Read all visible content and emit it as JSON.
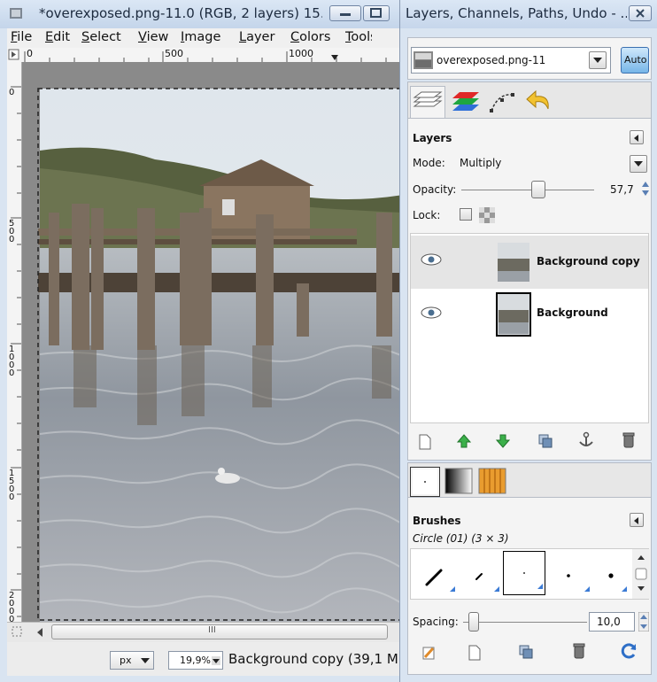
{
  "image_window": {
    "title": "*overexposed.png-11.0 (RGB, 2 layers) 15...",
    "menu": [
      "File",
      "Edit",
      "Select",
      "View",
      "Image",
      "Layer",
      "Colors",
      "Tools"
    ],
    "ruler_h_ticks": [
      "0",
      "500",
      "1000"
    ],
    "ruler_v_ticks": [
      "0",
      "500",
      "1000",
      "1500",
      "2000"
    ],
    "status": {
      "unit": "px",
      "zoom": "19,9%",
      "message": "Background copy (39,1 M"
    },
    "scroll_mark": "III"
  },
  "dock": {
    "title": "Layers, Channels, Paths, Undo - ...",
    "image_select": "overexposed.png-11",
    "auto_label": "Auto",
    "layers": {
      "heading": "Layers",
      "mode_label": "Mode:",
      "mode_value": "Multiply",
      "opacity_label": "Opacity:",
      "opacity_value": "57,7",
      "opacity_fraction": 0.577,
      "lock_label": "Lock:",
      "items": [
        {
          "name": "Background copy",
          "visible": true,
          "selected": true
        },
        {
          "name": "Background",
          "visible": true,
          "selected": false
        }
      ]
    },
    "brushes": {
      "heading": "Brushes",
      "current": "Circle (01) (3 × 3)",
      "spacing_label": "Spacing:",
      "spacing_value": "10,0"
    }
  }
}
